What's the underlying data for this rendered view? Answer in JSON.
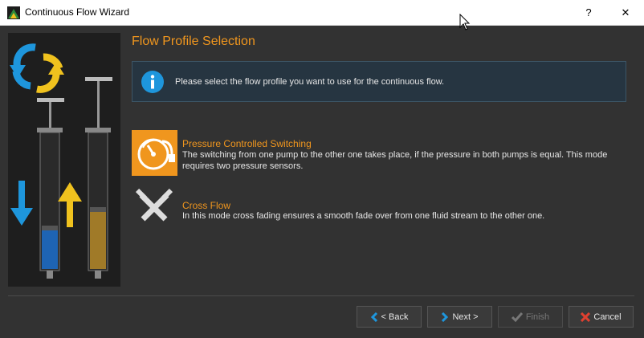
{
  "window": {
    "title": "Continuous Flow Wizard",
    "help_label": "?",
    "close_label": "✕"
  },
  "page": {
    "title": "Flow Profile Selection",
    "info": "Please select the flow profile you want to use for the continuous flow."
  },
  "options": [
    {
      "title": "Pressure Controlled Switching",
      "description": "The switching from one pump to the other one takes place, if the pressure in both pumps is equal. This mode requires two pressure sensors.",
      "icon": "gauge-icon",
      "selected": true
    },
    {
      "title": "Cross Flow",
      "description": "In this mode cross fading ensures a smooth fade over from one fluid stream to the other one.",
      "icon": "cross-tools-icon",
      "selected": false
    }
  ],
  "buttons": {
    "back": "< Back",
    "next": "Next >",
    "finish": "Finish",
    "cancel": "Cancel"
  },
  "colors": {
    "accent": "#f0961e",
    "background": "#323232",
    "info_bg": "#263541",
    "icon_blue": "#1e96dc"
  }
}
